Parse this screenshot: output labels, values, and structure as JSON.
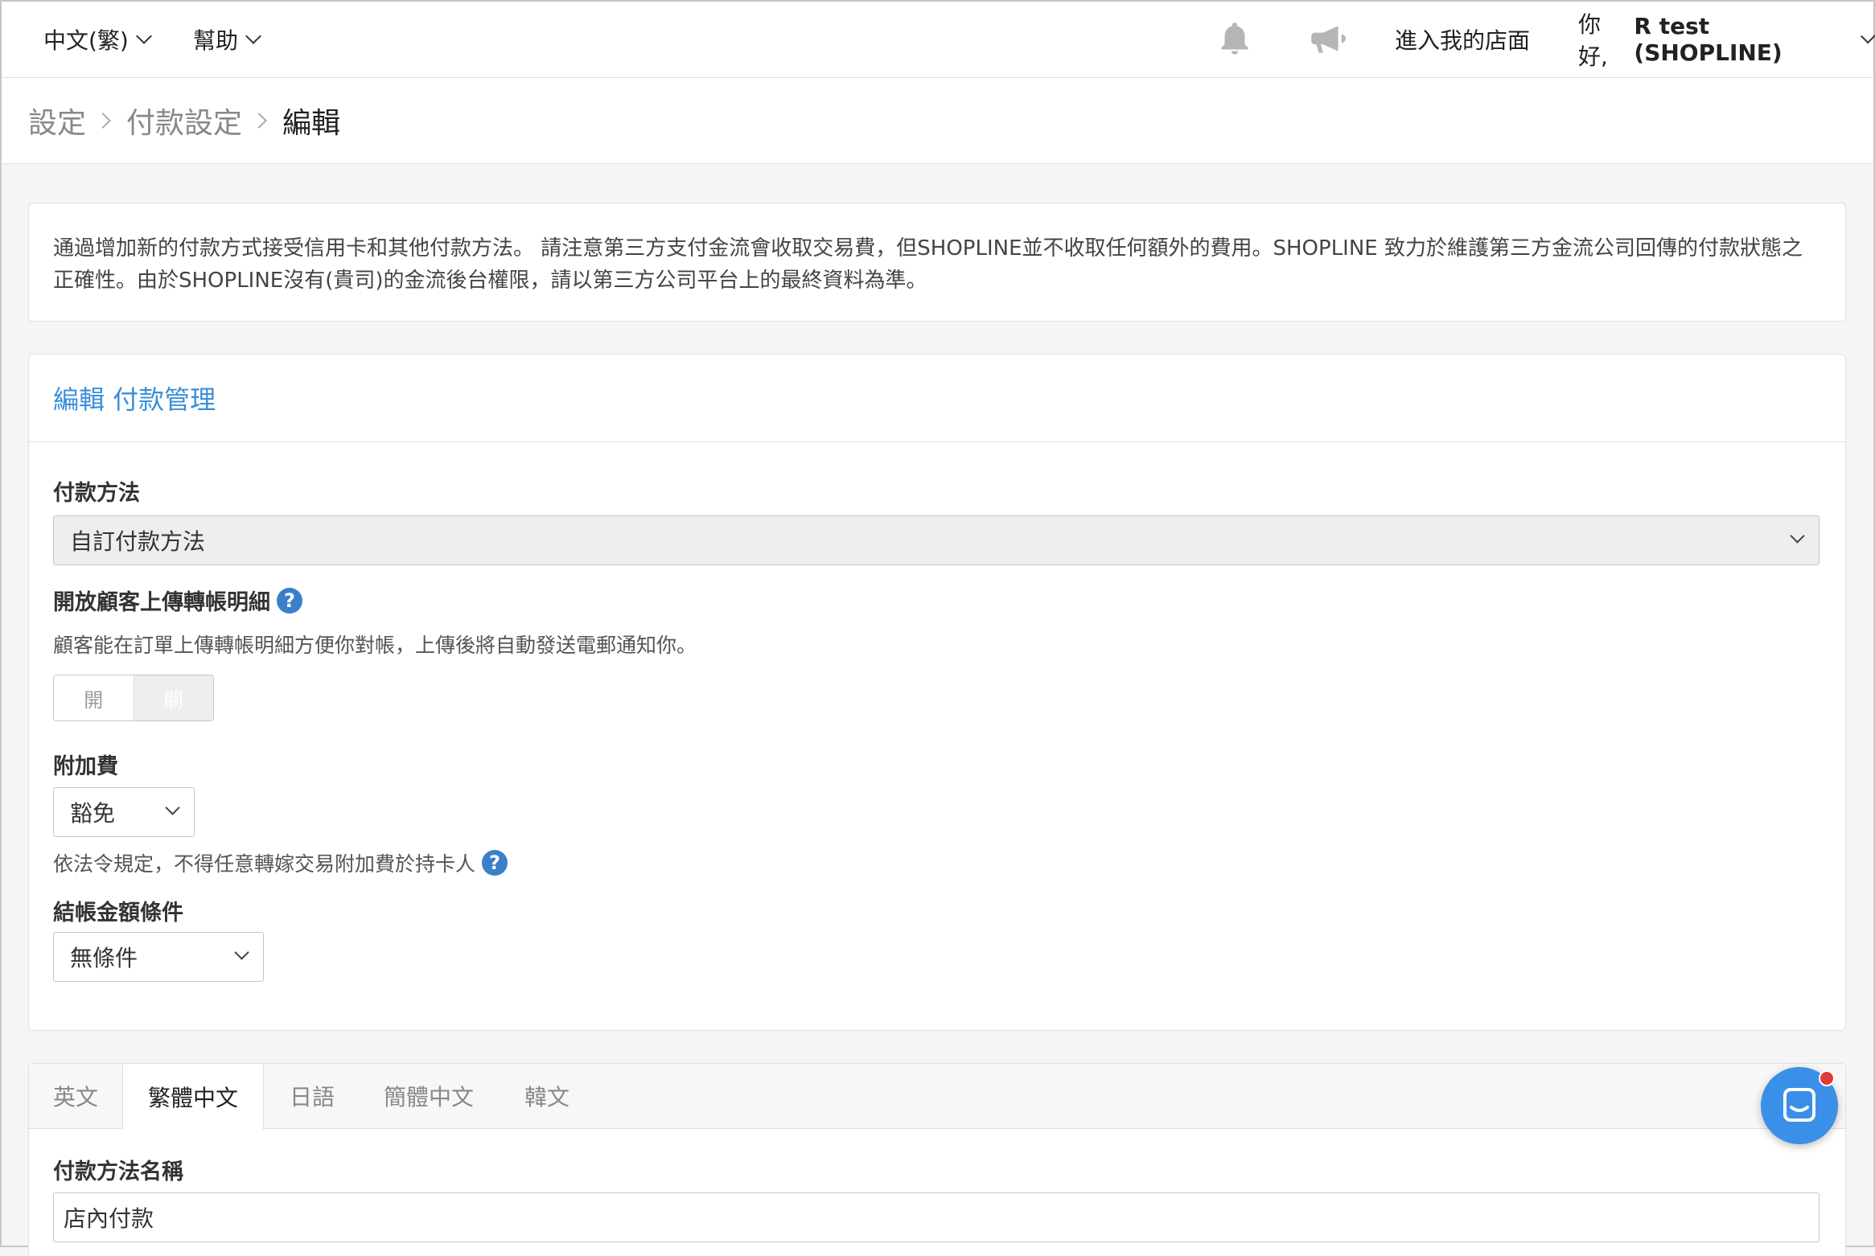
{
  "topbar": {
    "language": "中文(繁)",
    "help": "幫助",
    "store_link": "進入我的店面",
    "greeting": "你好,",
    "user_name": "R test (SHOPLINE)"
  },
  "breadcrumb": {
    "items": [
      "設定",
      "付款設定"
    ],
    "current": "編輯"
  },
  "notice": {
    "text": "通過增加新的付款方式接受信用卡和其他付款方法。 請注意第三方支付金流會收取交易費，但SHOPLINE並不收取任何額外的費用。SHOPLINE 致力於維護第三方金流公司回傳的付款狀態之正確性。由於SHOPLINE沒有(貴司)的金流後台權限，請以第三方公司平台上的最終資料為準。"
  },
  "edit_panel": {
    "title": "編輯 付款管理",
    "payment_method": {
      "label": "付款方法",
      "selected": "自訂付款方法"
    },
    "upload_receipt": {
      "label": "開放顧客上傳轉帳明細",
      "description": "顧客能在訂單上傳轉帳明細方便你對帳，上傳後將自動發送電郵通知你。",
      "toggle_on": "開",
      "toggle_off": "關",
      "state": "off"
    },
    "surcharge": {
      "label": "附加費",
      "selected": "豁免",
      "note": "依法令規定，不得任意轉嫁交易附加費於持卡人"
    },
    "checkout_condition": {
      "label": "結帳金額條件",
      "selected": "無條件"
    },
    "help_symbol": "?"
  },
  "language_panel": {
    "tabs": [
      "英文",
      "繁體中文",
      "日語",
      "簡體中文",
      "韓文"
    ],
    "active_tab": "繁體中文",
    "name_label": "付款方法名稱",
    "name_value": "店內付款"
  },
  "colors": {
    "accent": "#3a8fd8",
    "help_icon": "#3a7fc9",
    "fab": "#3a8fe8",
    "notification_dot": "#e03b3b"
  }
}
